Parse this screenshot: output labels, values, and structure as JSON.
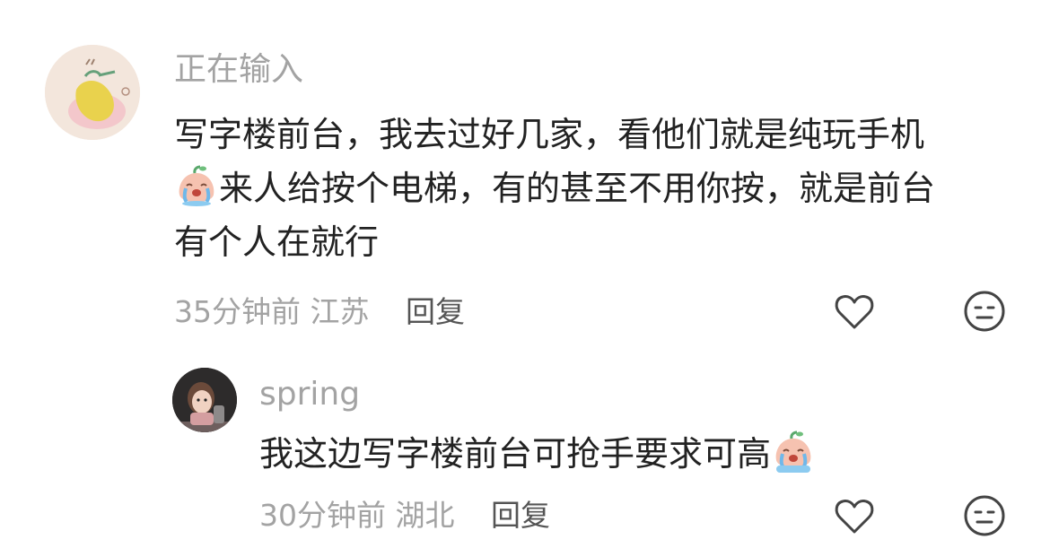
{
  "comment": {
    "username": "正在输入",
    "lines": [
      "写字楼前台，我去过好几家，看他们就是纯玩手机",
      "来人给按个电梯，有的甚至不用你按，就是前台",
      "有个人在就行"
    ],
    "time": "35分钟前",
    "location": "江苏",
    "reply_label": "回复"
  },
  "reply": {
    "username": "spring",
    "text": "我这边写字楼前台可抢手要求可高",
    "time": "30分钟前",
    "location": "湖北",
    "reply_label": "回复"
  },
  "icons": {
    "like": "heart-outline-icon",
    "dislike": "neutral-face-icon",
    "emoji": "crying-peach-emoji-icon"
  },
  "colors": {
    "muted": "#a3a3a3",
    "text": "#222222",
    "reply_link": "#555555"
  }
}
